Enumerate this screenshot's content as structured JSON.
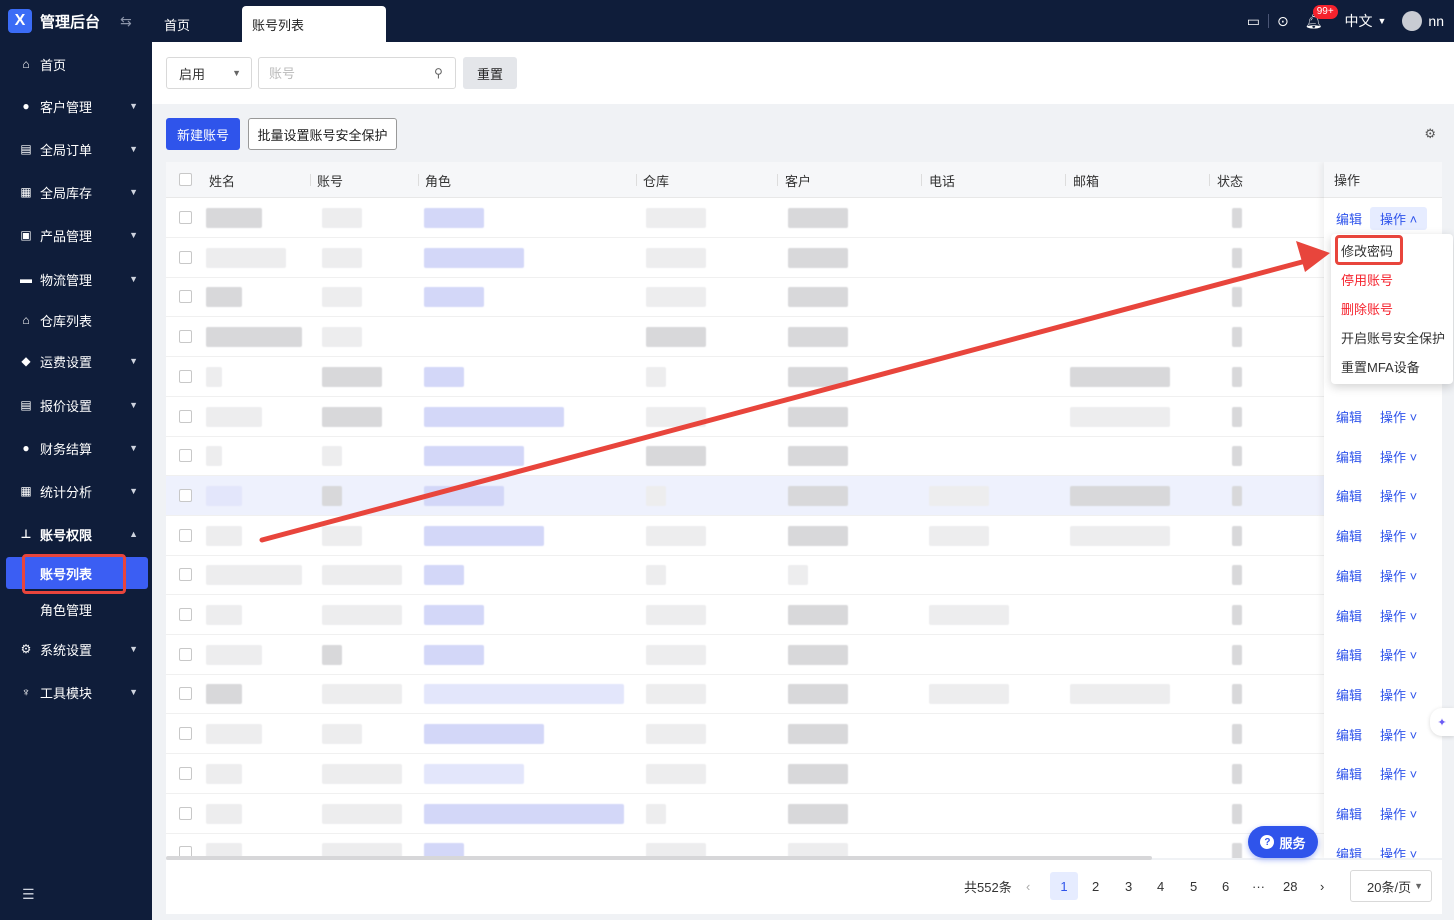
{
  "app": {
    "logo_icon": "app-logo-icon",
    "title": "管理后台"
  },
  "tabs": [
    {
      "label": "首页"
    },
    {
      "label": "账号列表"
    }
  ],
  "topbar": {
    "badge": "99+",
    "language": "中文",
    "username": "nn"
  },
  "sidebar": {
    "items": [
      {
        "label": "首页",
        "icon": "home-icon"
      },
      {
        "label": "客户管理",
        "icon": "users-icon"
      },
      {
        "label": "全局订单",
        "icon": "order-icon"
      },
      {
        "label": "全局库存",
        "icon": "inventory-icon"
      },
      {
        "label": "产品管理",
        "icon": "product-icon"
      },
      {
        "label": "物流管理",
        "icon": "truck-icon"
      },
      {
        "label": "仓库列表",
        "icon": "warehouse-icon"
      },
      {
        "label": "运费设置",
        "icon": "freight-icon"
      },
      {
        "label": "报价设置",
        "icon": "quote-icon"
      },
      {
        "label": "财务结算",
        "icon": "finance-icon"
      },
      {
        "label": "统计分析",
        "icon": "chart-icon"
      },
      {
        "label": "账号权限",
        "icon": "org-icon"
      },
      {
        "label": "系统设置",
        "icon": "gear-icon"
      },
      {
        "label": "工具模块",
        "icon": "tool-icon"
      }
    ],
    "sub_items": [
      {
        "label": "账号列表"
      },
      {
        "label": "角色管理"
      }
    ]
  },
  "filter": {
    "status_value": "启用",
    "search_placeholder": "账号",
    "reset_label": "重置"
  },
  "toolbar": {
    "new_label": "新建账号",
    "batch_label": "批量设置账号安全保护"
  },
  "table": {
    "columns": [
      "姓名",
      "账号",
      "角色",
      "仓库",
      "客户",
      "电话",
      "邮箱",
      "状态"
    ],
    "op_header": "操作",
    "edit_label": "编辑",
    "op_label": "操作"
  },
  "dropdown": {
    "items": [
      {
        "label": "修改密码",
        "danger": false
      },
      {
        "label": "停用账号",
        "danger": true
      },
      {
        "label": "删除账号",
        "danger": true
      },
      {
        "label": "开启账号安全保护",
        "danger": false
      },
      {
        "label": "重置MFA设备",
        "danger": false
      }
    ]
  },
  "pagination": {
    "total": "共552条",
    "pages": [
      "1",
      "2",
      "3",
      "4",
      "5",
      "6",
      "···",
      "28"
    ],
    "current": "1",
    "page_size": "20条/页"
  },
  "service_label": "服务",
  "colors": {
    "accent": "#2f54eb",
    "sidebar_bg": "#0f1d3a",
    "danger": "#f5222d",
    "annotation": "#e8453c"
  }
}
